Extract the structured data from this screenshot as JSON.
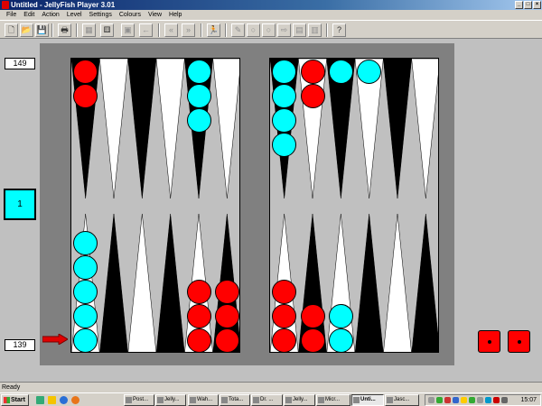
{
  "window": {
    "title": "Untitled - JellyFish Player 3.01",
    "buttons": [
      "_",
      "□",
      "×"
    ]
  },
  "menu": [
    "File",
    "Edit",
    "Action",
    "Level",
    "Settings",
    "Colours",
    "View",
    "Help"
  ],
  "toolbar": {
    "icons": [
      {
        "name": "new-file-icon",
        "glyph": "🗋"
      },
      {
        "name": "open-folder-icon",
        "glyph": "📂"
      },
      {
        "name": "save-icon",
        "glyph": "💾"
      },
      {
        "name": "print-icon",
        "glyph": "🖶"
      },
      {
        "name": "board-icon",
        "glyph": "▦"
      },
      {
        "name": "roll-dice-icon",
        "glyph": "⚅"
      },
      {
        "name": "position-icon",
        "glyph": "▣"
      },
      {
        "name": "undo-icon",
        "glyph": "←"
      },
      {
        "name": "rewind-icon",
        "glyph": "«"
      },
      {
        "name": "fast-forward-icon",
        "glyph": "»"
      },
      {
        "name": "runner-icon",
        "glyph": "🏃"
      },
      {
        "name": "pencil-icon",
        "glyph": "✎"
      },
      {
        "name": "circle-icon",
        "glyph": "○"
      },
      {
        "name": "circle-alt-icon",
        "glyph": "○"
      },
      {
        "name": "arrow-right-icon",
        "glyph": "⇨"
      },
      {
        "name": "grid-icon",
        "glyph": "▤"
      },
      {
        "name": "table-icon",
        "glyph": "▥"
      },
      {
        "name": "hint-icon",
        "glyph": "?"
      }
    ]
  },
  "board": {
    "top_pip_count": "149",
    "bottom_pip_count": "139",
    "cube_value": "1",
    "colors": {
      "player": "#00ffff",
      "opponent": "#ff0000",
      "dark_point": "#000000",
      "light_point": "#ffffff",
      "board": "#c0c0c0",
      "frame": "#808080"
    },
    "checkers": {
      "left_top": [
        {
          "point": 0,
          "color": "red",
          "count": 2
        },
        {
          "point": 4,
          "color": "cyan",
          "count": 3
        }
      ],
      "left_bottom": [
        {
          "point": 0,
          "color": "cyan",
          "count": 5
        },
        {
          "point": 4,
          "color": "red",
          "count": 3
        },
        {
          "point": 5,
          "color": "red",
          "count": 3
        }
      ],
      "right_top": [
        {
          "point": 0,
          "color": "cyan",
          "count": 4
        },
        {
          "point": 1,
          "color": "red",
          "count": 2
        },
        {
          "point": 2,
          "color": "cyan",
          "count": 1
        },
        {
          "point": 3,
          "color": "cyan",
          "count": 1
        }
      ],
      "right_bottom": [
        {
          "point": 0,
          "color": "red",
          "count": 3
        },
        {
          "point": 1,
          "color": "red",
          "count": 2
        },
        {
          "point": 2,
          "color": "cyan",
          "count": 2
        }
      ]
    },
    "dice": [
      1,
      1
    ]
  },
  "status": {
    "text": "Ready"
  },
  "taskbar": {
    "start_label": "Start",
    "quick_launch": [
      "desktop-icon",
      "outlook-icon",
      "ie-icon",
      "firefox-icon"
    ],
    "tasks": [
      {
        "label": "Post...",
        "active": false
      },
      {
        "label": "Jelly...",
        "active": false
      },
      {
        "label": "Wah...",
        "active": false
      },
      {
        "label": "Tota...",
        "active": false
      },
      {
        "label": "Dr. ...",
        "active": false
      },
      {
        "label": "Jelly...",
        "active": false
      },
      {
        "label": "Micr...",
        "active": false
      },
      {
        "label": "Unti...",
        "active": true
      },
      {
        "label": "Jasc...",
        "active": false
      }
    ],
    "clock": "15:07"
  }
}
